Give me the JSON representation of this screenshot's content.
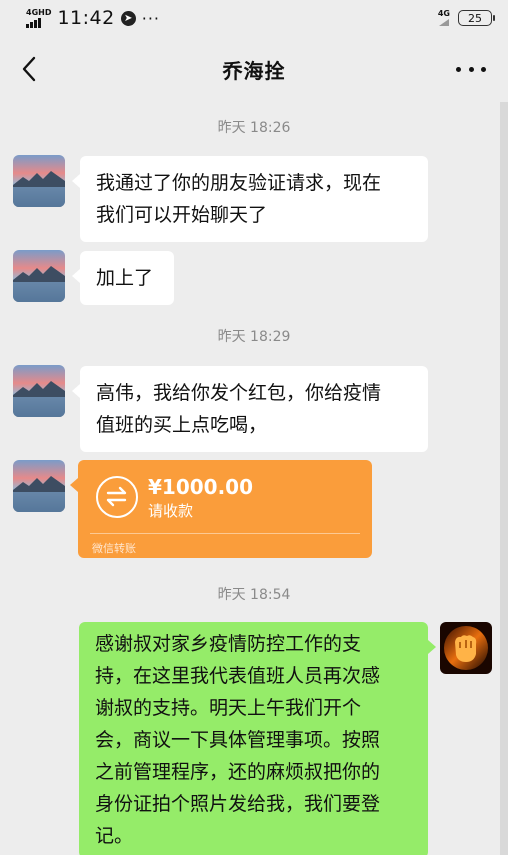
{
  "status_bar": {
    "network_left": "4GHD",
    "time": "11:42",
    "more": "···",
    "network_right": "4G",
    "battery": "25"
  },
  "header": {
    "title": "乔海拴",
    "back_icon": "chevron-left-icon",
    "more_icon": "more-horizontal-icon"
  },
  "messages": {
    "ts1": "昨天 18:26",
    "m1": [
      "我通过了你的朋友验证请求，现在",
      "我们可以开始聊天了"
    ],
    "m2": "加上了",
    "ts2": "昨天 18:29",
    "m3": [
      "高伟，我给你发个红包，你给疫情",
      "值班的买上点吃喝，"
    ],
    "transfer": {
      "amount": "¥1000.00",
      "status": "请收款",
      "footer": "微信转账",
      "icon": "transfer-arrows-icon"
    },
    "ts3": "昨天 18:54",
    "m4": [
      "感谢叔对家乡疫情防控工作的支",
      "持，在这里我代表值班人员再次感",
      "谢叔的支持。明天上午我们开个",
      "会，商议一下具体管理事项。按照",
      "之前管理程序，还的麻烦叔把你的",
      "身份证拍个照片发给我，我们要登",
      "记。"
    ]
  },
  "colors": {
    "background": "#ededed",
    "incoming_bubble": "#ffffff",
    "outgoing_bubble": "#95ec69",
    "transfer_card": "#fa9d3b"
  }
}
